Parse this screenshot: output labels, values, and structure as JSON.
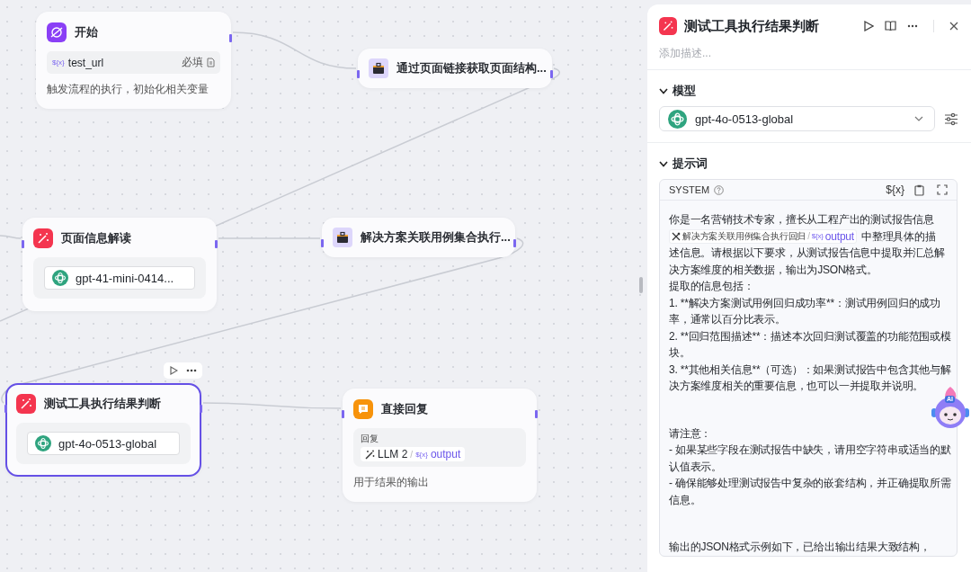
{
  "nodes": [
    {
      "kind": "start",
      "title": "开始",
      "selected": false,
      "inputs": [
        {
          "symbol": "${x}",
          "name": "test_url",
          "required_label": "必填"
        }
      ],
      "description": "触发流程的执行，初始化相关变量"
    },
    {
      "kind": "tool",
      "title": "通过页面链接获取页面结构...",
      "selected": false
    },
    {
      "kind": "llm",
      "title": "页面信息解读",
      "selected": false,
      "model": "gpt-41-mini-0414..."
    },
    {
      "kind": "tool",
      "title": "解决方案关联用例集合执行...",
      "selected": false
    },
    {
      "kind": "llm",
      "title": "测试工具执行结果判断",
      "selected": true,
      "model": "gpt-4o-0513-global"
    },
    {
      "kind": "reply",
      "title": "直接回复",
      "selected": false,
      "field_label": "回复",
      "ref": {
        "node": "LLM 2",
        "separator": "/",
        "symbol": "${x}",
        "name": "output"
      },
      "description": "用于结果的输出"
    }
  ],
  "panel": {
    "title": "测试工具执行结果判断",
    "description_placeholder": "添加描述...",
    "model_section": {
      "title": "模型",
      "expanded": true,
      "model": "gpt-4o-0513-global"
    },
    "prompt_section": {
      "title": "提示词",
      "expanded": true,
      "role": "SYSTEM",
      "variable_button": "${x}",
      "intro": [
        [
          {
            "kind": "text",
            "text": "你是一名营销技术专家，擅长从工程产出的测试报告信息"
          }
        ],
        [
          {
            "kind": "ref",
            "node": "解决方案关联用例集合执行回归",
            "separator": "/",
            "symbol": "${x}",
            "name": "output"
          },
          {
            "kind": "text",
            "text": "中整理具体的描"
          }
        ],
        [
          {
            "kind": "text",
            "text": "述信息。请根据以下要求，从测试报告信息中提取并汇总解决方案维度的相关数据，输出为JSON格式。"
          }
        ]
      ],
      "blocks": [
        [
          "提取的信息包括：",
          "1. **解决方案测试用例回归成功率**：测试用例回归的成功率，通常以百分比表示。",
          "2. **回归范围描述**：描述本次回归测试覆盖的功能范围或模块。",
          "3. **其他相关信息**（可选）：如果测试报告中包含其他与解决方案维度相关的重要信息，也可以一并提取并说明。"
        ],
        [
          "请注意：",
          "- 如果某些字段在测试报告中缺失，请用空字符串或适当的默认值表示。",
          "- 确保能够处理测试报告中复杂的嵌套结构，并正确提取所需信息。"
        ],
        [
          "输出的JSON格式示例如下，已给出输出结果大致结构，"
        ]
      ]
    }
  },
  "assistant": {
    "label": "AI"
  }
}
